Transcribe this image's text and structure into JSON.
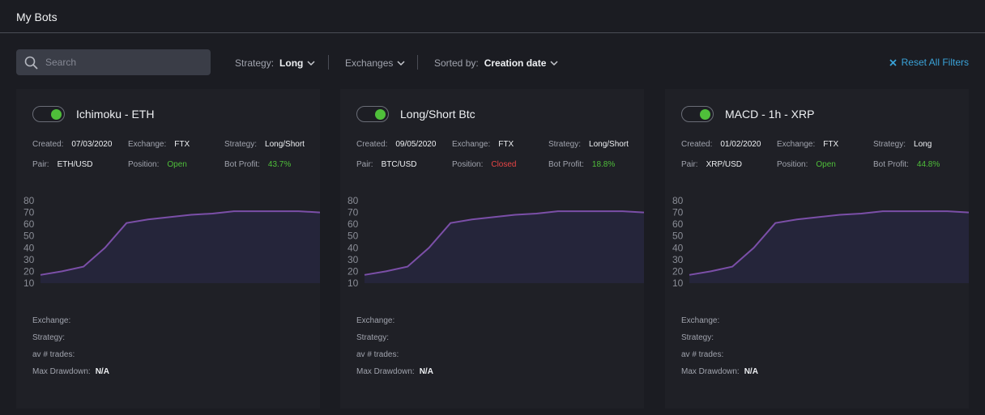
{
  "header": {
    "title": "My Bots"
  },
  "search": {
    "placeholder": "Search",
    "value": ""
  },
  "filters": {
    "strategy_label": "Strategy:",
    "strategy_value": "Long",
    "exchanges_label": "Exchanges",
    "sorted_label": "Sorted by:",
    "sorted_value": "Creation date",
    "reset_label": "Reset All Filters"
  },
  "colors": {
    "accent": "#3aa2d8",
    "on": "#4fbf3a",
    "open": "#4fbf3a",
    "closed": "#e84545",
    "chart_line": "#7b4fa8",
    "chart_fill": "#25253a"
  },
  "bots": [
    {
      "name": "Ichimoku - ETH",
      "enabled": true,
      "created_label": "Created:",
      "created": "07/03/2020",
      "exchange_label": "Exchange:",
      "exchange": "FTX",
      "strategy_label": "Strategy:",
      "strategy": "Long/Short",
      "pair_label": "Pair:",
      "pair": "ETH/USD",
      "position_label": "Position:",
      "position": "Open",
      "profit_label": "Bot Profit:",
      "profit": "43.7%",
      "stats": [
        {
          "label": "Exchange:",
          "value": ""
        },
        {
          "label": "Strategy:",
          "value": ""
        },
        {
          "label": "av # trades:",
          "value": ""
        },
        {
          "label": "Max Drawdown:",
          "value": "N/A"
        }
      ]
    },
    {
      "name": "Long/Short Btc",
      "enabled": true,
      "created_label": "Created:",
      "created": "09/05/2020",
      "exchange_label": "Exchange:",
      "exchange": "FTX",
      "strategy_label": "Strategy:",
      "strategy": "Long/Short",
      "pair_label": "Pair:",
      "pair": "BTC/USD",
      "position_label": "Position:",
      "position": "Closed",
      "profit_label": "Bot Profit:",
      "profit": "18.8%",
      "stats": [
        {
          "label": "Exchange:",
          "value": ""
        },
        {
          "label": "Strategy:",
          "value": ""
        },
        {
          "label": "av # trades:",
          "value": ""
        },
        {
          "label": "Max Drawdown:",
          "value": "N/A"
        }
      ]
    },
    {
      "name": "MACD - 1h - XRP",
      "enabled": true,
      "created_label": "Created:",
      "created": "01/02/2020",
      "exchange_label": "Exchange:",
      "exchange": "FTX",
      "strategy_label": "Strategy:",
      "strategy": "Long",
      "pair_label": "Pair:",
      "pair": "XRP/USD",
      "position_label": "Position:",
      "position": "Open",
      "profit_label": "Bot Profit:",
      "profit": "44.8%",
      "stats": [
        {
          "label": "Exchange:",
          "value": ""
        },
        {
          "label": "Strategy:",
          "value": ""
        },
        {
          "label": "av # trades:",
          "value": ""
        },
        {
          "label": "Max Drawdown:",
          "value": "N/A"
        }
      ]
    }
  ],
  "chart_data": {
    "type": "area",
    "ylim": [
      10,
      80
    ],
    "yticks": [
      "80",
      "70",
      "60",
      "50",
      "40",
      "30",
      "20",
      "10"
    ],
    "x": [
      0,
      1,
      2,
      3,
      4,
      5,
      6,
      7,
      8,
      9,
      10,
      11,
      12,
      13
    ],
    "values": [
      17,
      20,
      24,
      40,
      61,
      64,
      66,
      68,
      69,
      71,
      71,
      71,
      71,
      70
    ]
  }
}
